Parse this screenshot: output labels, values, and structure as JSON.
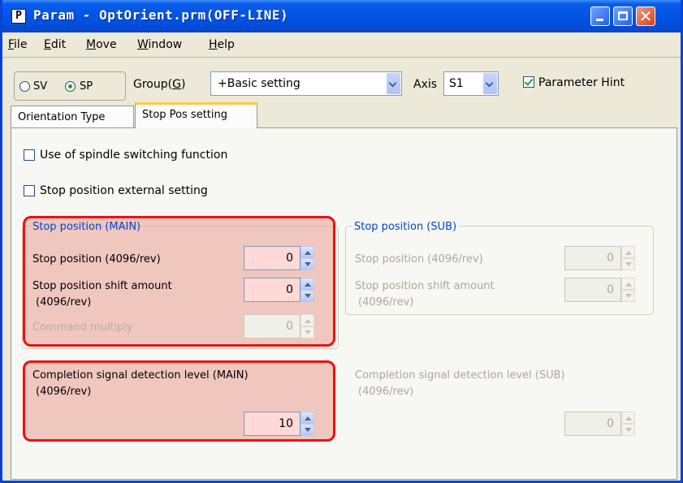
{
  "window": {
    "title": "Param - OptOrient.prm(OFF-LINE)",
    "app_icon_letter": "P",
    "close_glyph": "✕"
  },
  "menubar": {
    "items": [
      {
        "accel": "F",
        "rest": "ile"
      },
      {
        "accel": "E",
        "rest": "dit"
      },
      {
        "accel": "M",
        "rest": "ove"
      },
      {
        "accel": "W",
        "rest": "indow"
      },
      {
        "accel": "H",
        "rest": "elp"
      }
    ]
  },
  "toolbar": {
    "radio_sv": "SV",
    "radio_sp": "SP",
    "selected_radio": "SP",
    "group_label": "Group(",
    "group_accel": "G",
    "group_label_end": ")",
    "group_value": "+Basic setting",
    "axis_label": "Axis",
    "axis_value": "S1",
    "hint_label": "Parameter Hint",
    "hint_checked": true
  },
  "tabs": [
    {
      "label": "Orientation Type",
      "active": false
    },
    {
      "label": "Stop Pos setting",
      "active": true
    }
  ],
  "options": {
    "spindle_switching": {
      "label": "Use of spindle switching function",
      "checked": false
    },
    "external_setting": {
      "label": "Stop position external setting",
      "checked": false
    }
  },
  "main_group": {
    "title": "Stop position (MAIN)",
    "stop_position_label": "Stop position (4096/rev)",
    "stop_position_value": "0",
    "shift_label_1": "Stop position shift amount",
    "shift_label_2": "(4096/rev)",
    "shift_value": "0",
    "multiply_label": "Command multiply",
    "multiply_value": "0"
  },
  "sub_group": {
    "title": "Stop position (SUB)",
    "stop_position_label": "Stop position (4096/rev)",
    "stop_position_value": "0",
    "shift_label_1": "Stop position shift amount",
    "shift_label_2": "(4096/rev)",
    "shift_value": "0"
  },
  "completion_main": {
    "label_1": "Completion signal detection level (MAIN)",
    "label_2": "(4096/rev)",
    "value": "10"
  },
  "completion_sub": {
    "label_1": "Completion signal detection level (SUB)",
    "label_2": "(4096/rev)",
    "value": "0"
  },
  "colors": {
    "titlebar": "#0256e6",
    "highlight_border": "#ee1111",
    "highlight_fill": "#eba091",
    "group_title": "#0046d5",
    "disabled_text": "#aca899"
  }
}
